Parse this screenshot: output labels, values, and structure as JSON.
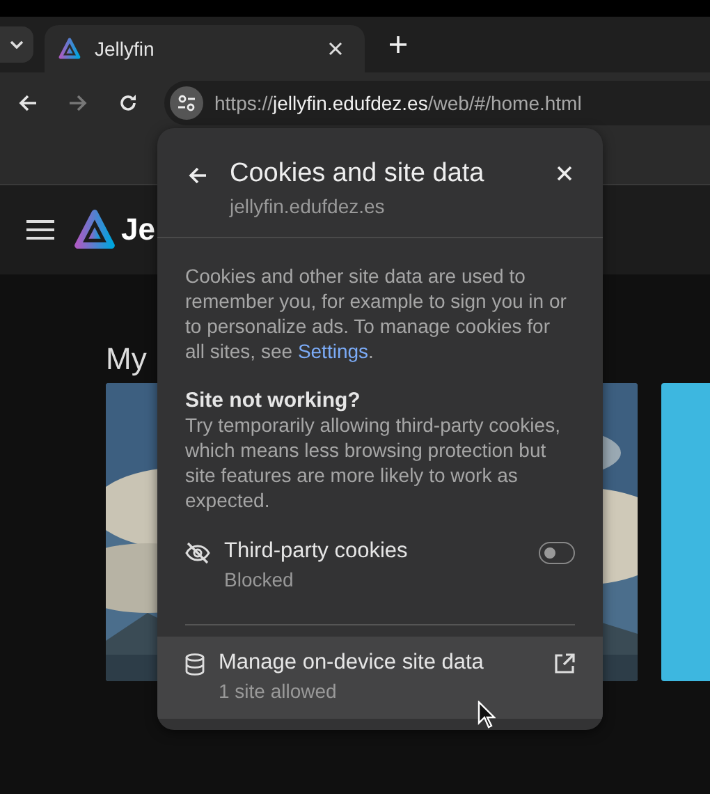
{
  "browser": {
    "tabs": [
      {
        "title": "Jellyfin",
        "selected": true
      }
    ],
    "nav": [
      {
        "kind": "back",
        "disabled": false
      },
      {
        "kind": "forward",
        "disabled": true
      },
      {
        "kind": "reload",
        "disabled": false
      }
    ],
    "url": {
      "scheme": "https://",
      "host": "jellyfin.edufdez.es",
      "path": "/web/#/home.html"
    }
  },
  "page": {
    "logo_text": "Je",
    "section_title": "My"
  },
  "popup": {
    "title": "Cookies and site data",
    "subtitle": "jellyfin.edufdez.es",
    "description": "Cookies and other site data are used to remember you, for example to sign you in or to personalize ads. To manage cookies for all sites, see ",
    "link": "Settings",
    "description_end": ".",
    "help_title": "Site not working?",
    "help_text": "Try temporarily allowing third-party cookies, which means less browsing protection but site features are more likely to work as expected.",
    "toggle": {
      "label": "Third-party cookies",
      "status": "Blocked",
      "on": false
    },
    "manage": {
      "label": "Manage on-device site data",
      "status": "1 site allowed",
      "hovered": true
    }
  }
}
